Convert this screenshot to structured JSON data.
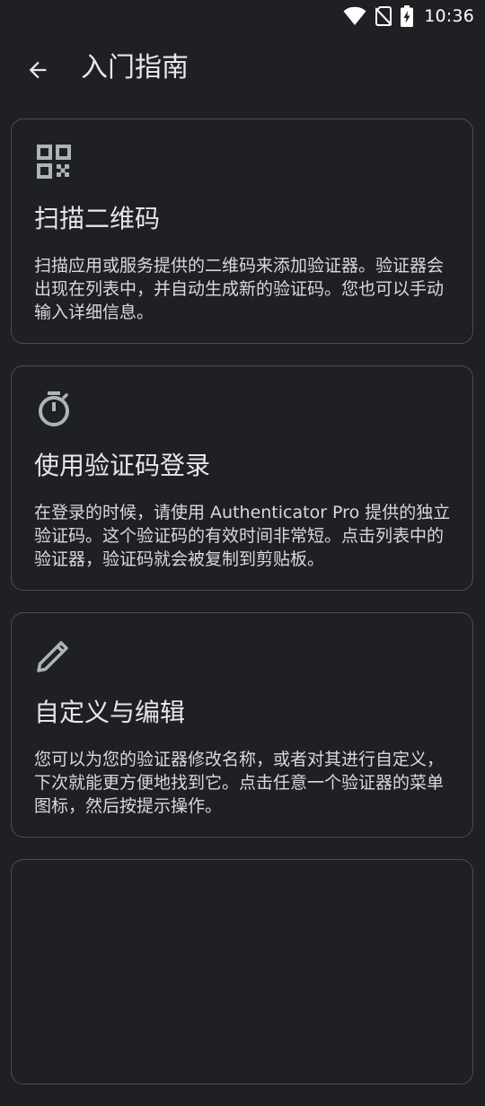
{
  "status_bar": {
    "time": "10:36",
    "icons": [
      "wifi-icon",
      "no-sim-icon",
      "battery-charging-icon"
    ]
  },
  "app_bar": {
    "back_icon": "arrow-back-icon",
    "title": "入门指南"
  },
  "cards": [
    {
      "icon": "qr-code-icon",
      "title": "扫描二维码",
      "body": "扫描应用或服务提供的二维码来添加验证器。验证器会出现在列表中，并自动生成新的验证码。您也可以手动输入详细信息。"
    },
    {
      "icon": "timer-icon",
      "title": "使用验证码登录",
      "body": "在登录的时候，请使用 Authenticator Pro 提供的独立验证码。这个验证码的有效时间非常短。点击列表中的验证器，验证码就会被复制到剪贴板。"
    },
    {
      "icon": "pencil-icon",
      "title": "自定义与编辑",
      "body": "您可以为您的验证器修改名称，或者对其进行自定义，下次就能更方便地找到它。点击任意一个验证器的菜单图标，然后按提示操作。"
    }
  ],
  "colors": {
    "background": "#1e2023",
    "card_border": "#4a4d53",
    "icon": "#aeb3ba",
    "text": "#e6e7ea"
  }
}
